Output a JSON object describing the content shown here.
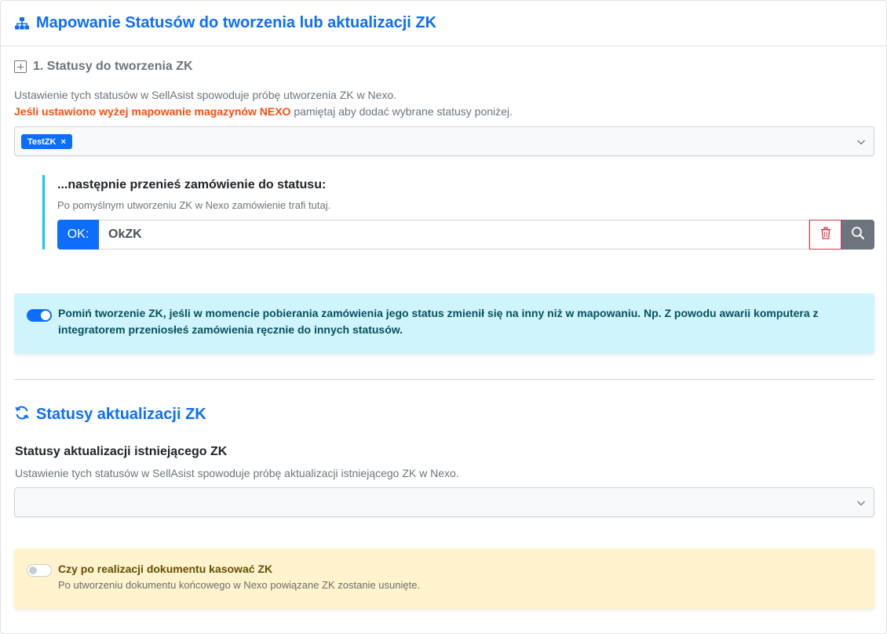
{
  "header": {
    "title": "Mapowanie Statusów do tworzenia lub aktualizacji ZK",
    "icon": "sitemap-icon"
  },
  "section_create": {
    "heading": "1. Statusy do tworzenia ZK",
    "expand_icon": "plus-square-icon",
    "description": "Ustawienie tych statusów w SellAsist spowoduje próbę utworzenia ZK w Nexo.",
    "warning_bold": "Jeśli ustawiono wyżej mapowanie magazynów NEXO",
    "warning_rest": " pamiętaj aby dodać wybrane statusy poniżej.",
    "selected_tags": [
      {
        "label": "TestZK",
        "remove": "×"
      }
    ],
    "next": {
      "title": "...następnie przenieś zamówienie do statusu:",
      "description": "Po pomyślnym utworzeniu ZK w Nexo zamówienie trafi tutaj.",
      "prefix": "OK:",
      "value": "OkZK"
    }
  },
  "skip_alert": {
    "toggle_on": true,
    "text": "Pomiń tworzenie ZK, jeśli w momencie pobierania zamówienia jego status zmienił się na inny niż w mapowaniu. Np. Z powodu awarii komputera z integratorem przeniosłeś zamówienia ręcznie do innych statusów."
  },
  "section_update": {
    "title": "Statusy aktualizacji ZK",
    "icon": "sync-icon",
    "sub_title": "Statusy aktualizacji istniejącego ZK",
    "sub_description": "Ustawienie tych statusów w SellAsist spowoduje próbę aktualizacji istniejącego ZK w Nexo.",
    "selected_tags": []
  },
  "delete_alert": {
    "toggle_on": false,
    "title": "Czy po realizacji dokumentu kasować ZK",
    "description": "Po utworzeniu dokumentu końcowego w Nexo powiązane ZK zostanie usunięte."
  },
  "colors": {
    "primary": "#0d6efd",
    "info_bg": "#cff4fc",
    "warning_bg": "#fff3cd",
    "danger": "#dc3545",
    "warning_text": "#fd4e0c"
  }
}
